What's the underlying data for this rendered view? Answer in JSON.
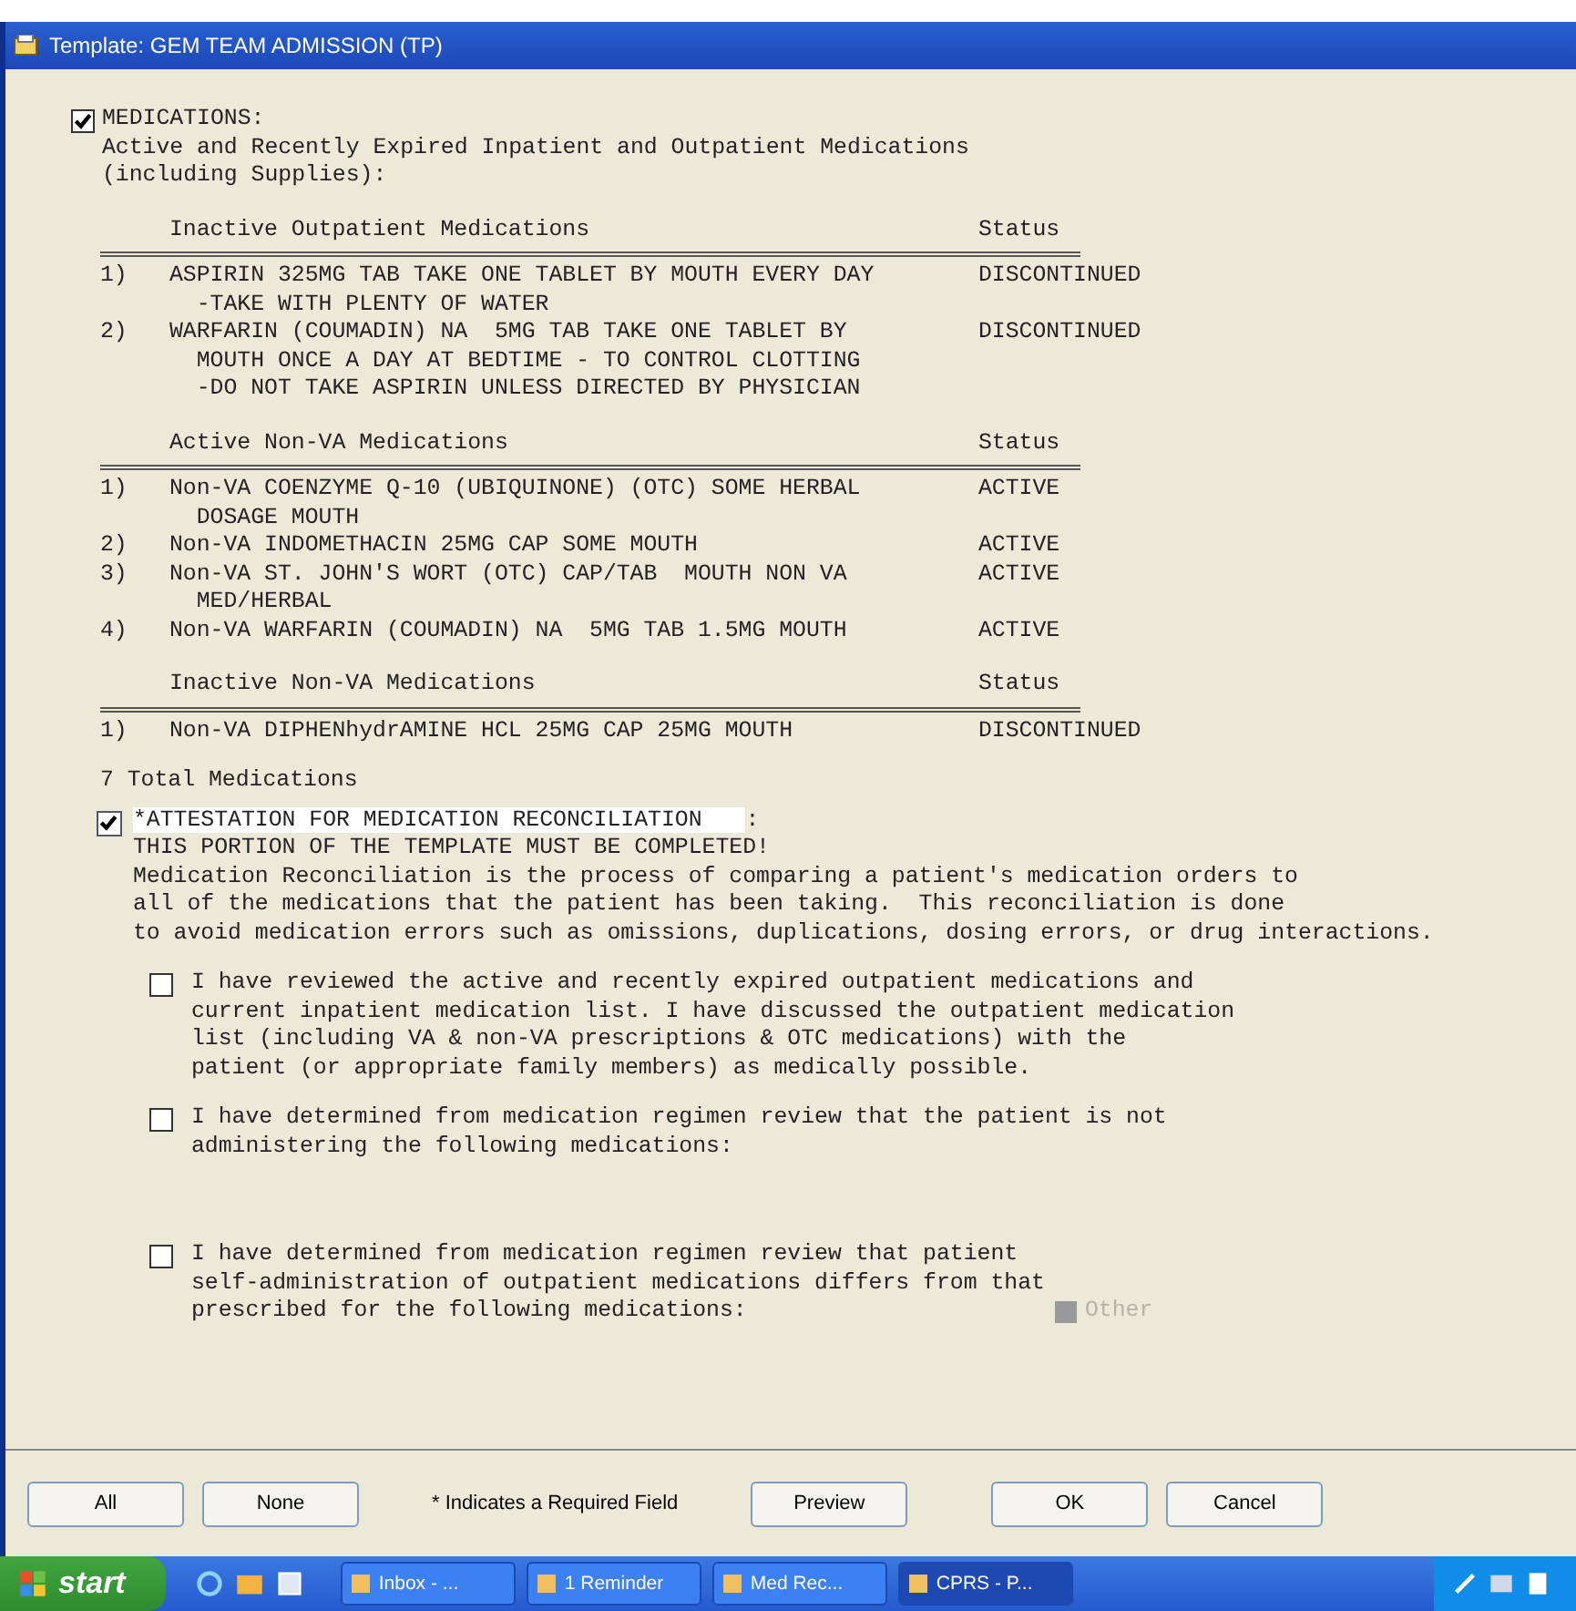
{
  "window": {
    "title": "Template: GEM TEAM ADMISSION (TP)"
  },
  "medications": {
    "checked": true,
    "title": "MEDICATIONS:",
    "intro": [
      "Active and Recently Expired Inpatient and Outpatient Medications",
      "(including Supplies):"
    ],
    "sections": [
      {
        "heading": "Inactive Outpatient Medications",
        "status_heading": "Status",
        "rows": [
          {
            "number": "1)",
            "lines": [
              "ASPIRIN 325MG TAB TAKE ONE TABLET BY MOUTH EVERY DAY",
              "  -TAKE WITH PLENTY OF WATER"
            ],
            "status": "DISCONTINUED"
          },
          {
            "number": "2)",
            "lines": [
              "WARFARIN (COUMADIN) NA  5MG TAB TAKE ONE TABLET BY",
              "  MOUTH ONCE A DAY AT BEDTIME - TO CONTROL CLOTTING",
              "  -DO NOT TAKE ASPIRIN UNLESS DIRECTED BY PHYSICIAN"
            ],
            "status": "DISCONTINUED"
          }
        ]
      },
      {
        "heading": "Active Non-VA Medications",
        "status_heading": "Status",
        "rows": [
          {
            "number": "1)",
            "lines": [
              "Non-VA COENZYME Q-10 (UBIQUINONE) (OTC) SOME HERBAL",
              "  DOSAGE MOUTH"
            ],
            "status": "ACTIVE"
          },
          {
            "number": "2)",
            "lines": [
              "Non-VA INDOMETHACIN 25MG CAP SOME MOUTH"
            ],
            "status": "ACTIVE"
          },
          {
            "number": "3)",
            "lines": [
              "Non-VA ST. JOHN'S WORT (OTC) CAP/TAB  MOUTH NON VA",
              "  MED/HERBAL"
            ],
            "status": "ACTIVE"
          },
          {
            "number": "4)",
            "lines": [
              "Non-VA WARFARIN (COUMADIN) NA  5MG TAB 1.5MG MOUTH"
            ],
            "status": "ACTIVE"
          }
        ]
      },
      {
        "heading": "Inactive Non-VA Medications",
        "status_heading": "Status",
        "rows": [
          {
            "number": "1)",
            "lines": [
              "Non-VA DIPHENhydrAMINE HCL 25MG CAP 25MG MOUTH"
            ],
            "status": "DISCONTINUED"
          }
        ]
      }
    ],
    "total": "7 Total Medications"
  },
  "attestation": {
    "checked": true,
    "label": "*ATTESTATION FOR MEDICATION RECONCILIATION",
    "colon": ":",
    "warning": "THIS PORTION OF THE TEMPLATE MUST BE COMPLETED!",
    "paragraph": [
      "Medication Reconciliation is the process of comparing a patient's medication orders to",
      "all of the medications that the patient has been taking.  This reconciliation is done",
      "to avoid medication errors such as omissions, duplications, dosing errors, or drug interactions."
    ],
    "items": [
      {
        "checked": false,
        "lines": [
          "I have reviewed the active and recently expired outpatient medications and",
          "current inpatient medication list. I have discussed the outpatient medication",
          "list (including VA & non-VA prescriptions & OTC medications) with the",
          "patient (or appropriate family members) as medically possible."
        ]
      },
      {
        "checked": false,
        "lines": [
          "I have determined from medication regimen review that the patient is not",
          "administering the following medications:"
        ]
      },
      {
        "checked": false,
        "lines": [
          "I have determined from medication regimen review that patient",
          "self-administration of outpatient medications differs from that",
          "prescribed for the following medications:"
        ],
        "option": {
          "label": "Other",
          "disabled": true
        }
      }
    ]
  },
  "footer": {
    "buttons_left": [
      "All",
      "None"
    ],
    "note": "* Indicates a Required Field",
    "buttons_right": [
      "Preview",
      "OK",
      "Cancel"
    ]
  },
  "taskbar": {
    "start": "start",
    "tasks": [
      {
        "label": "Inbox - ...",
        "selected": false
      },
      {
        "label": "1 Reminder",
        "selected": false
      },
      {
        "label": "Med Rec...",
        "selected": false
      },
      {
        "label": "CPRS - P...",
        "selected": true
      }
    ]
  }
}
